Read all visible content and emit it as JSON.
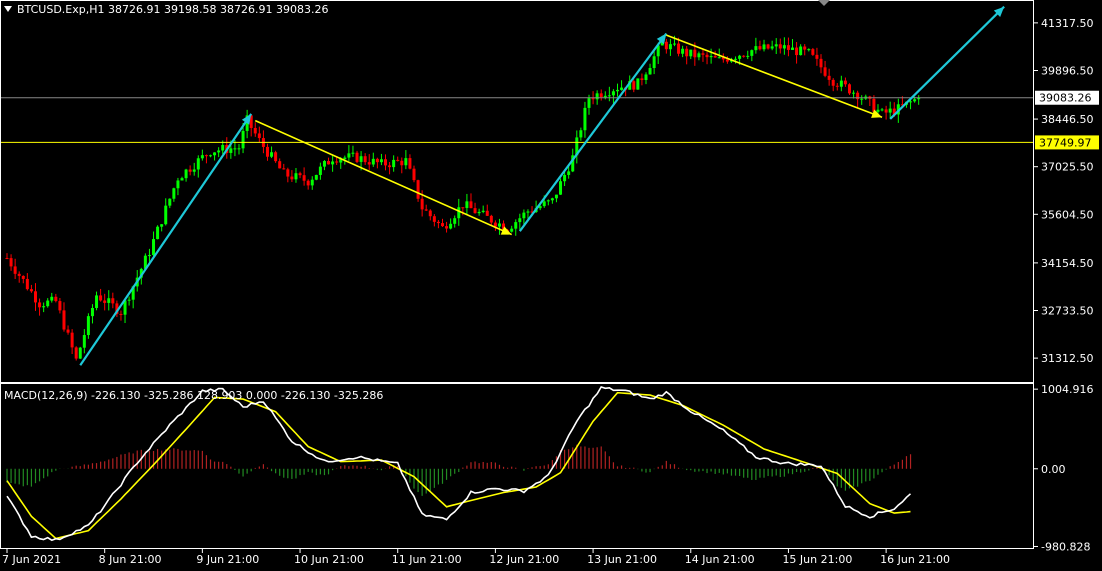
{
  "header": {
    "symbol": "BTCUSD.Exp,H1",
    "ohlc": "38726.91 39198.58 38726.91 39083.26",
    "collapse_icon": "triangle-down-icon"
  },
  "macd_header": {
    "text": "MACD(12,26,9) -226.130 -325.286 128.903 0.000 -226.130 -325.286"
  },
  "colors": {
    "background": "#000000",
    "bull": "#00ff00",
    "bear": "#ff0000",
    "trend_up": "#1ec8d8",
    "trend_down": "#ffff00",
    "macd_line": "#ffffff",
    "signal_line": "#ffff00",
    "hist_pos": "#b22222",
    "hist_neg": "#228b22",
    "axis": "#ffffff",
    "level_price": "#ffff00",
    "current_line": "#888888"
  },
  "chart_data": [
    {
      "type": "candlestick",
      "title": "BTCUSD.Exp,H1",
      "ylim": [
        30600,
        42000
      ],
      "y_ticks": [
        "41317.50",
        "39896.50",
        "38446.50",
        "37025.50",
        "35604.50",
        "34154.50",
        "32733.50",
        "31312.50"
      ],
      "y_tick_values": [
        41317.5,
        39896.5,
        38446.5,
        37025.5,
        35604.5,
        34154.5,
        32733.5,
        31312.5
      ],
      "x_ticks": [
        "7 Jun 2021",
        "8 Jun 21:00",
        "9 Jun 21:00",
        "10 Jun 21:00",
        "11 Jun 21:00",
        "12 Jun 21:00",
        "13 Jun 21:00",
        "14 Jun 21:00",
        "15 Jun 21:00",
        "16 Jun 21:00"
      ],
      "x_tick_bars": [
        0,
        24,
        48,
        72,
        96,
        120,
        144,
        168,
        192,
        216
      ],
      "current_price": {
        "label": "39083.26",
        "value": 39083.26
      },
      "level_line": {
        "label": "37749.97",
        "value": 37749.97
      },
      "anchor_closes": [
        {
          "bar": 0,
          "v": 34300
        },
        {
          "bar": 8,
          "v": 32950
        },
        {
          "bar": 12,
          "v": 33000
        },
        {
          "bar": 17,
          "v": 31250
        },
        {
          "bar": 22,
          "v": 33200
        },
        {
          "bar": 28,
          "v": 32700
        },
        {
          "bar": 35,
          "v": 34500
        },
        {
          "bar": 42,
          "v": 36700
        },
        {
          "bar": 50,
          "v": 37500
        },
        {
          "bar": 57,
          "v": 37600
        },
        {
          "bar": 59,
          "v": 38400
        },
        {
          "bar": 62,
          "v": 37800
        },
        {
          "bar": 68,
          "v": 36800
        },
        {
          "bar": 74,
          "v": 36600
        },
        {
          "bar": 80,
          "v": 37300
        },
        {
          "bar": 86,
          "v": 37300
        },
        {
          "bar": 92,
          "v": 37100
        },
        {
          "bar": 98,
          "v": 37200
        },
        {
          "bar": 102,
          "v": 35800
        },
        {
          "bar": 107,
          "v": 35200
        },
        {
          "bar": 112,
          "v": 35900
        },
        {
          "bar": 118,
          "v": 35500
        },
        {
          "bar": 123,
          "v": 35200
        },
        {
          "bar": 128,
          "v": 35700
        },
        {
          "bar": 134,
          "v": 36000
        },
        {
          "bar": 139,
          "v": 37300
        },
        {
          "bar": 143,
          "v": 39100
        },
        {
          "bar": 150,
          "v": 39400
        },
        {
          "bar": 155,
          "v": 39500
        },
        {
          "bar": 161,
          "v": 40700
        },
        {
          "bar": 167,
          "v": 40400
        },
        {
          "bar": 175,
          "v": 40200
        },
        {
          "bar": 183,
          "v": 40500
        },
        {
          "bar": 190,
          "v": 40600
        },
        {
          "bar": 197,
          "v": 40400
        },
        {
          "bar": 203,
          "v": 39600
        },
        {
          "bar": 209,
          "v": 39200
        },
        {
          "bar": 215,
          "v": 38600
        },
        {
          "bar": 219,
          "v": 38750
        },
        {
          "bar": 224,
          "v": 39083.26
        }
      ],
      "trend_arrows": [
        {
          "color": "trend_up",
          "from": {
            "bar": 18,
            "v": 31100
          },
          "to": {
            "bar": 60,
            "v": 38600
          }
        },
        {
          "color": "trend_down",
          "from": {
            "bar": 61,
            "v": 38400
          },
          "to": {
            "bar": 124,
            "v": 35000
          }
        },
        {
          "color": "trend_up",
          "from": {
            "bar": 126,
            "v": 35100
          },
          "to": {
            "bar": 162,
            "v": 41000
          }
        },
        {
          "color": "trend_down",
          "from": {
            "bar": 162,
            "v": 40950
          },
          "to": {
            "bar": 215,
            "v": 38500
          }
        },
        {
          "color": "trend_up",
          "from": {
            "bar": 217,
            "v": 38450
          },
          "to": {
            "bar": 245,
            "v": 41800
          }
        }
      ]
    },
    {
      "type": "line",
      "title": "MACD(12,26,9)",
      "ylim": [
        -1000,
        1070
      ],
      "y_ticks": [
        "1004.916",
        "0.00",
        "-980.828"
      ],
      "y_tick_values": [
        1004.916,
        0,
        -980.828
      ],
      "macd_anchors": [
        {
          "bar": 0,
          "v": -350
        },
        {
          "bar": 6,
          "v": -850
        },
        {
          "bar": 12,
          "v": -900
        },
        {
          "bar": 20,
          "v": -720
        },
        {
          "bar": 25,
          "v": -400
        },
        {
          "bar": 32,
          "v": 80
        },
        {
          "bar": 40,
          "v": 550
        },
        {
          "bar": 48,
          "v": 980
        },
        {
          "bar": 53,
          "v": 1000
        },
        {
          "bar": 58,
          "v": 780
        },
        {
          "bar": 63,
          "v": 860
        },
        {
          "bar": 70,
          "v": 350
        },
        {
          "bar": 78,
          "v": 90
        },
        {
          "bar": 86,
          "v": 150
        },
        {
          "bar": 96,
          "v": 60
        },
        {
          "bar": 102,
          "v": -580
        },
        {
          "bar": 108,
          "v": -640
        },
        {
          "bar": 114,
          "v": -300
        },
        {
          "bar": 120,
          "v": -250
        },
        {
          "bar": 127,
          "v": -280
        },
        {
          "bar": 133,
          "v": -90
        },
        {
          "bar": 140,
          "v": 600
        },
        {
          "bar": 146,
          "v": 1020
        },
        {
          "bar": 152,
          "v": 980
        },
        {
          "bar": 158,
          "v": 880
        },
        {
          "bar": 162,
          "v": 960
        },
        {
          "bar": 168,
          "v": 730
        },
        {
          "bar": 176,
          "v": 480
        },
        {
          "bar": 184,
          "v": 150
        },
        {
          "bar": 191,
          "v": 70
        },
        {
          "bar": 200,
          "v": 40
        },
        {
          "bar": 206,
          "v": -470
        },
        {
          "bar": 212,
          "v": -600
        },
        {
          "bar": 218,
          "v": -500
        },
        {
          "bar": 222,
          "v": -320
        }
      ],
      "signal_anchors": [
        {
          "bar": 0,
          "v": -150
        },
        {
          "bar": 6,
          "v": -600
        },
        {
          "bar": 12,
          "v": -880
        },
        {
          "bar": 20,
          "v": -780
        },
        {
          "bar": 28,
          "v": -380
        },
        {
          "bar": 36,
          "v": 50
        },
        {
          "bar": 44,
          "v": 500
        },
        {
          "bar": 51,
          "v": 900
        },
        {
          "bar": 58,
          "v": 880
        },
        {
          "bar": 66,
          "v": 720
        },
        {
          "bar": 74,
          "v": 280
        },
        {
          "bar": 82,
          "v": 90
        },
        {
          "bar": 92,
          "v": 110
        },
        {
          "bar": 100,
          "v": -100
        },
        {
          "bar": 108,
          "v": -480
        },
        {
          "bar": 114,
          "v": -400
        },
        {
          "bar": 122,
          "v": -300
        },
        {
          "bar": 130,
          "v": -230
        },
        {
          "bar": 136,
          "v": -50
        },
        {
          "bar": 144,
          "v": 600
        },
        {
          "bar": 150,
          "v": 960
        },
        {
          "bar": 158,
          "v": 930
        },
        {
          "bar": 166,
          "v": 800
        },
        {
          "bar": 176,
          "v": 550
        },
        {
          "bar": 186,
          "v": 250
        },
        {
          "bar": 196,
          "v": 80
        },
        {
          "bar": 204,
          "v": -60
        },
        {
          "bar": 212,
          "v": -440
        },
        {
          "bar": 218,
          "v": -560
        },
        {
          "bar": 222,
          "v": -540
        }
      ]
    }
  ]
}
